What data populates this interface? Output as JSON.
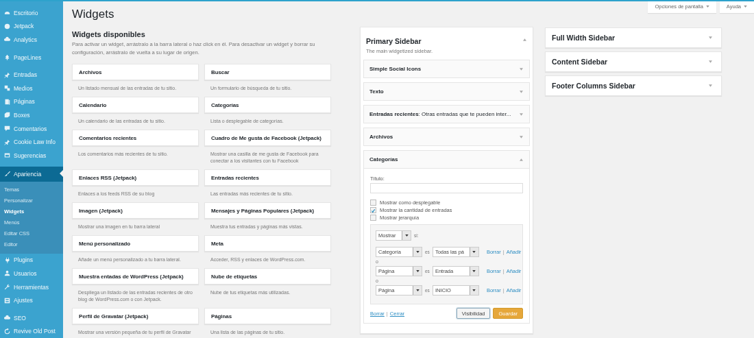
{
  "menu": [
    {
      "items": [
        {
          "label": "Escritorio",
          "selected": false
        },
        {
          "label": "Jetpack",
          "selected": false
        },
        {
          "label": "Analytics",
          "selected": false
        }
      ]
    },
    {
      "items": [
        {
          "label": "PageLines",
          "selected": false
        }
      ]
    },
    {
      "items": [
        {
          "label": "Entradas",
          "selected": false
        },
        {
          "label": "Medios",
          "selected": false
        },
        {
          "label": "Páginas",
          "selected": false
        },
        {
          "label": "Boxes",
          "selected": false
        },
        {
          "label": "Comentarios",
          "selected": false
        },
        {
          "label": "Cookie Law Info",
          "selected": false
        },
        {
          "label": "Sugerencias",
          "selected": false
        }
      ]
    },
    {
      "items": [
        {
          "label": "Apariencia",
          "selected": true,
          "children": [
            {
              "label": "Temas",
              "selected": false
            },
            {
              "label": "Personalizar",
              "selected": false
            },
            {
              "label": "Widgets",
              "selected": true
            },
            {
              "label": "Menús",
              "selected": false
            },
            {
              "label": "Editar CSS",
              "selected": false
            },
            {
              "label": "Editor",
              "selected": false
            }
          ]
        },
        {
          "label": "Plugins",
          "selected": false
        },
        {
          "label": "Usuarios",
          "selected": false
        },
        {
          "label": "Herramientas",
          "selected": false
        },
        {
          "label": "Ajustes",
          "selected": false
        }
      ]
    },
    {
      "items": [
        {
          "label": "SEO",
          "selected": false
        },
        {
          "label": "Revive Old Post",
          "selected": false
        }
      ]
    }
  ],
  "top_buttons": [
    "Opciones de pantalla",
    "Ayuda"
  ],
  "page_title": "Widgets",
  "available": {
    "title": "Widgets disponibles",
    "description": "Para activar un widget, arrástralo a la barra lateral o haz click en él. Para desactivar un widget y borrar su configuración, arrástralo de vuelta a su lugar de origen.",
    "widgets": [
      {
        "title": "Archivos",
        "description": "Un listado mensual de las entradas de tu sitio."
      },
      {
        "title": "Buscar",
        "description": "Un formulario de búsqueda de tu sitio."
      },
      {
        "title": "Calendario",
        "description": "Un calendario de las entradas de tu sitio."
      },
      {
        "title": "Categorías",
        "description": "Lista o desplegable de categorías."
      },
      {
        "title": "Comentarios recientes",
        "description": "Los comentarios más recientes de tu sitio."
      },
      {
        "title": "Cuadro de Me gusta de Facebook (Jetpack)",
        "description": "Mostrar una casilla de me gusta de Facebook para conectar a los visitantes con tu Facebook"
      },
      {
        "title": "Enlaces RSS (Jetpack)",
        "description": "Enlaces a los feeds RSS de su blog"
      },
      {
        "title": "Entradas recientes",
        "description": "Las entradas más recientes de tu sitio."
      },
      {
        "title": "Imagen (Jetpack)",
        "description": "Mostrar una imagen en tu barra lateral"
      },
      {
        "title": "Mensajes y Páginas Populares (Jetpack)",
        "description": "Muestra tus entradas y páginas más vistas."
      },
      {
        "title": "Menú personalizado",
        "description": "Añade un menú personalizado a tu barra lateral."
      },
      {
        "title": "Meta",
        "description": "Acceder, RSS y enlaces de WordPress.com."
      },
      {
        "title": "Muestra entadas de WordPress (Jetpack)",
        "description": "Despliega un listado de las entradas recientes de otro blog de WordPress.com o con Jetpack."
      },
      {
        "title": "Nube de etiquetas",
        "description": "Nube de tus etiquetas más utilizadas."
      },
      {
        "title": "Perfil de Gravatar (Jetpack)",
        "description": "Mostrar una versión pequeña de tu perfil de Gravatar"
      },
      {
        "title": "Páginas",
        "description": "Una lista de las páginas de tu sitio."
      }
    ]
  },
  "primary_sidebar": {
    "title": "Primary Sidebar",
    "description": "The main widgetized sidebar.",
    "expanded": true,
    "widgets": [
      {
        "title": "Simple Social Icons",
        "expanded": false
      },
      {
        "title": "Texto",
        "expanded": false
      },
      {
        "title": "Entradas recientes",
        "subtitle": ": Otras entradas que te pueden inter...",
        "expanded": false
      },
      {
        "title": "Archivos",
        "expanded": false
      },
      {
        "title": "Categorías",
        "expanded": true,
        "form": {
          "title_label": "Título:",
          "checkboxes": [
            {
              "label": "Mostrar como desplegable",
              "checked": false
            },
            {
              "label": "Mostrar la cantidad de entradas",
              "checked": true
            },
            {
              "label": "Mostrar jerarquía",
              "checked": false
            }
          ],
          "visibility": {
            "action": "Mostrar",
            "suffix": "si:",
            "rules": [
              {
                "field": "Categoría",
                "operator": "es",
                "value": "Todas las pá",
                "links": [
                  "Borrar",
                  "|",
                  "Añadir"
                ]
              },
              {
                "separator": "o",
                "field": "Página",
                "operator": "es",
                "value": "Entrada",
                "links": [
                  "Borrar",
                  "|",
                  "Añadir"
                ]
              },
              {
                "separator": "o",
                "field": "Página",
                "operator": "es",
                "value": "INICIO",
                "links": [
                  "Borrar",
                  "|",
                  "Añadir"
                ]
              }
            ]
          },
          "footer_links": [
            "Borrar",
            "|",
            "Cerrar"
          ],
          "buttons": [
            {
              "label": "Visibilidad",
              "kind": "secondary"
            },
            {
              "label": "Guardar",
              "kind": "primary"
            }
          ]
        }
      }
    ]
  },
  "other_sidebars": [
    {
      "title": "Full Width Sidebar",
      "expanded": false
    },
    {
      "title": "Content Sidebar",
      "expanded": false
    },
    {
      "title": "Footer Columns Sidebar",
      "expanded": false
    }
  ]
}
